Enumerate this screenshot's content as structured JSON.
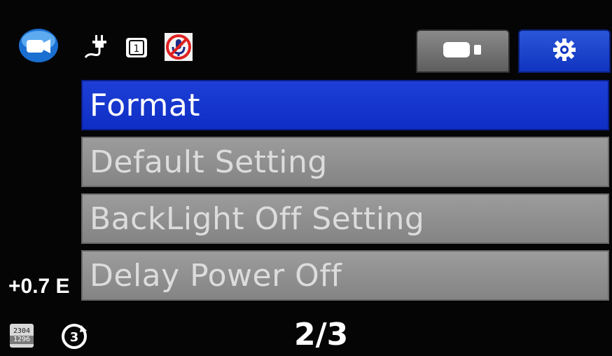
{
  "status_bar": {
    "mode_icon": "video-camera-icon",
    "power_icon": "power-plug-icon",
    "card_slot_label": "1",
    "mic_icon": "microphone-off-icon"
  },
  "tabs": [
    {
      "icon": "video-camera-icon",
      "active": false
    },
    {
      "icon": "gear-icon",
      "active": true
    }
  ],
  "menu": {
    "items": [
      {
        "label": "Format",
        "selected": true
      },
      {
        "label": "Default Setting",
        "selected": false
      },
      {
        "label": "BackLight Off Setting",
        "selected": false
      },
      {
        "label": "Delay Power Off",
        "selected": false
      }
    ]
  },
  "footer": {
    "ev_text": "+0.7 E",
    "resolution_top": "2304",
    "resolution_bottom": "1296",
    "loop_icon": "loop-recording-icon",
    "page": "2/3"
  },
  "colors": {
    "selected": "#1034c0",
    "item": "#8e8e8e",
    "background": "#050505"
  }
}
